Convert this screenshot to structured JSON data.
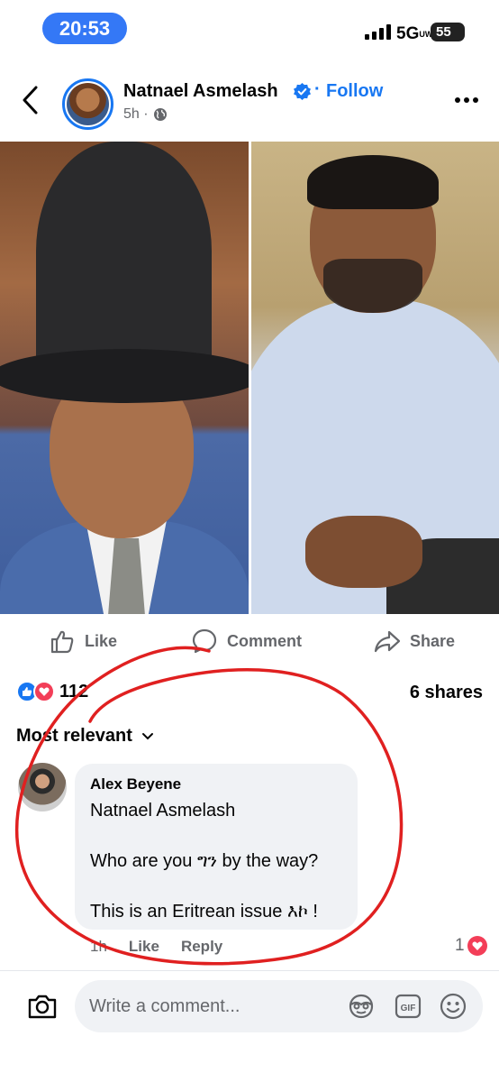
{
  "status_bar": {
    "time": "20:53",
    "network": "5G",
    "network_sup": "UW",
    "battery": "55"
  },
  "post": {
    "author": "Natnael Asmelash",
    "separator": "·",
    "follow_label": "Follow",
    "age": "5h ·",
    "icons": [
      "back-icon",
      "verified-icon",
      "globe-icon",
      "more-icon"
    ]
  },
  "actions": {
    "like_label": "Like",
    "comment_label": "Comment",
    "share_label": "Share"
  },
  "stats": {
    "reaction_count": "112",
    "shares": "6 shares"
  },
  "sort": {
    "label": "Most relevant"
  },
  "comment": {
    "author": "Alex Beyene",
    "text": "Natnael Asmelash\n\nWho are you ግን by the way?\n\nThis is an Eritrean issue እኮ !",
    "time": "1h",
    "like_label": "Like",
    "reply_label": "Reply",
    "reaction_count": "1"
  },
  "composer": {
    "placeholder": "Write a comment...",
    "icons": [
      "camera-icon",
      "sticker-icon",
      "gif-icon",
      "emoji-icon"
    ]
  },
  "colors": {
    "accent": "#1877f2",
    "love": "#f33e58",
    "annotation": "#e02020",
    "time_pill": "#3478f6"
  }
}
